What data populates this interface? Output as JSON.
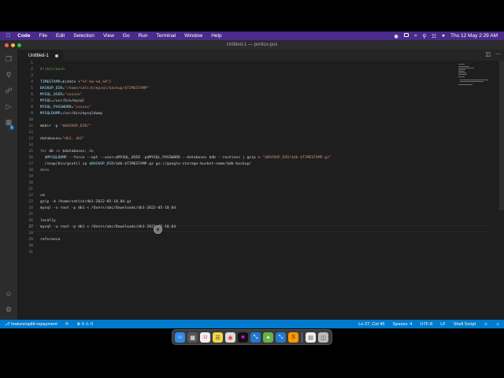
{
  "menubar": {
    "app_name": "Code",
    "items": [
      "File",
      "Edit",
      "Selection",
      "View",
      "Go",
      "Run",
      "Terminal",
      "Window",
      "Help"
    ],
    "datetime": "Thu 12 May  2:29 AM"
  },
  "window": {
    "title": "Untitled-1 — portico-pos"
  },
  "tab": {
    "label": "Untitled-1"
  },
  "editor": {
    "lines": [
      {
        "n": "1",
        "text": ""
      },
      {
        "n": "2",
        "text": "#!/bin/bash"
      },
      {
        "n": "3",
        "text": ""
      },
      {
        "n": "4",
        "text": "TIMESTAMP=$(date +\"%Y-%m-%d_%H\")"
      },
      {
        "n": "5",
        "text": "BACKUP_DIR=\"/home/satish/mysql/backup/$TIMESTAMP\""
      },
      {
        "n": "6",
        "text": "MYSQL_USER=\"xxxxxx\""
      },
      {
        "n": "7",
        "text": "MYSQL=/usr/bin/mysql"
      },
      {
        "n": "8",
        "text": "MYSQL_PASSWORD=\"xxxxxx\""
      },
      {
        "n": "9",
        "text": "MYSQLDUMP=/usr/bin/mysqldump"
      },
      {
        "n": "10",
        "text": ""
      },
      {
        "n": "11",
        "text": "mkdir -p \"$BACKUP_DIR/\""
      },
      {
        "n": "12",
        "text": ""
      },
      {
        "n": "13",
        "text": "databases=\"db1, db2\""
      },
      {
        "n": "14",
        "text": ""
      },
      {
        "n": "15",
        "text": "for db in $databases; do"
      },
      {
        "n": "16",
        "text": "  $MYSQLDUMP --force --opt --user=$MYSQL_USER -p$MYSQL_PASSWORD --databases $db --routines | gzip > \"$BACKUP_DIR/$db-$TIMESTAMP.gz\""
      },
      {
        "n": "17",
        "text": "  /snap/bin/gsutil cp $BACKUP_DIR/$db-$TIMESTAMP.gz gs://google-storage-bucket-name/$db-backup/"
      },
      {
        "n": "18",
        "text": "done"
      },
      {
        "n": "19",
        "text": ""
      },
      {
        "n": "20",
        "text": ""
      },
      {
        "n": "21",
        "text": ""
      },
      {
        "n": "22",
        "text": "vm"
      },
      {
        "n": "23",
        "text": "gzip -d /home/satish/db1-2022-05-10_04.gz"
      },
      {
        "n": "24",
        "text": "mysql -u root -p db1 < /Users/abc/Downloads/db1-2022-05-10_04"
      },
      {
        "n": "25",
        "text": ""
      },
      {
        "n": "26",
        "text": "locally"
      },
      {
        "n": "27",
        "text": "mysql -u root -p db1 < /Users/abc/Downloads/db1-2022-05-10_04"
      },
      {
        "n": "28",
        "text": ""
      },
      {
        "n": "29",
        "text": "reference"
      },
      {
        "n": "30",
        "text": ""
      },
      {
        "n": "31",
        "text": ""
      }
    ]
  },
  "statusbar": {
    "branch": "feature/splitt-repayment",
    "sync": "⟳",
    "problems": "⊗ 0 ⚠ 0",
    "position": "Ln 27, Col 45",
    "spaces": "Spaces: 4",
    "encoding": "UTF-8",
    "eol": "LF",
    "language": "Shell Script"
  },
  "colors": {
    "menubar_bg": "#4a2a8a",
    "statusbar_bg": "#007acc",
    "editor_bg": "#1e1e1e",
    "comment": "#6a9955",
    "string": "#ce9178",
    "keyword": "#c586c0",
    "variable": "#9cdcfe"
  },
  "icons": {
    "activity": [
      "explorer-icon",
      "search-icon",
      "source-control-icon",
      "run-debug-icon",
      "extensions-icon",
      "account-icon",
      "settings-gear-icon"
    ],
    "dock": [
      "finder-icon",
      "launchpad-icon",
      "calendar-icon",
      "notes-icon",
      "chrome-icon",
      "intellij-icon",
      "vscode-icon",
      "maps-icon",
      "vscode-alt-icon",
      "sublime-icon",
      "document-icon",
      "trash-icon"
    ]
  }
}
